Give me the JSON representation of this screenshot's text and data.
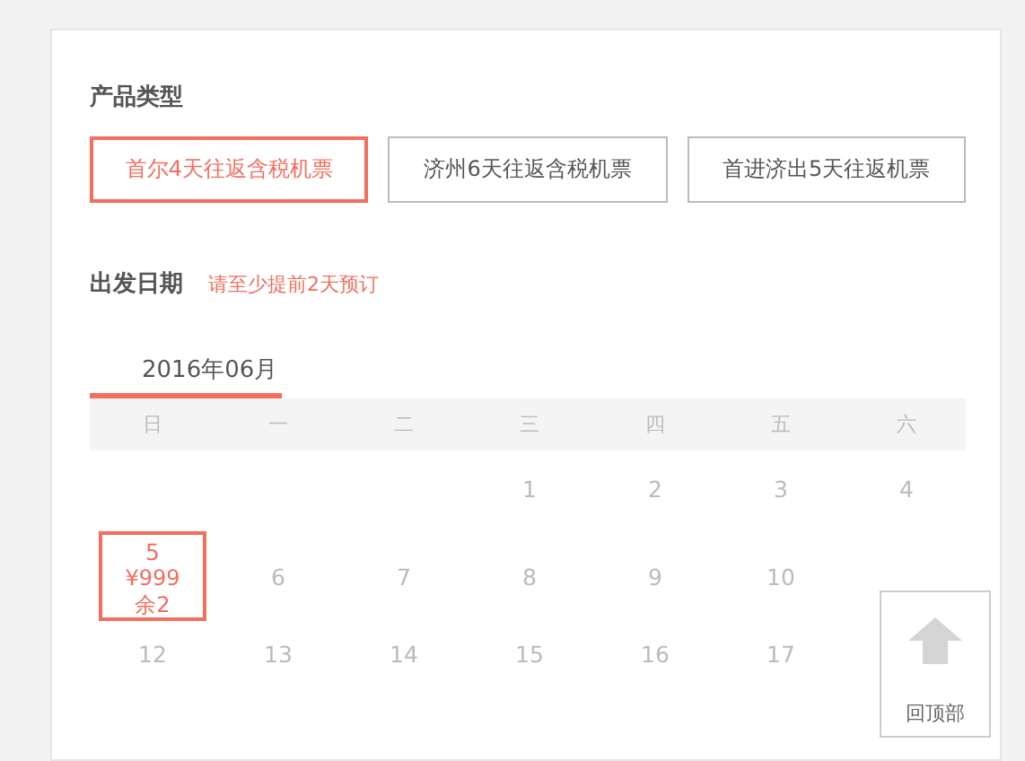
{
  "product_section": {
    "title": "产品类型",
    "options": [
      {
        "label": "首尔4天往返含税机票",
        "selected": true
      },
      {
        "label": "济州6天往返含税机票",
        "selected": false
      },
      {
        "label": "首进济出5天往返机票",
        "selected": false
      }
    ]
  },
  "date_section": {
    "title": "出发日期",
    "hint": "请至少提前2天预订",
    "month_tabs": [
      {
        "label": "2016年06月",
        "selected": true
      }
    ],
    "weekdays": [
      "日",
      "一",
      "二",
      "三",
      "四",
      "五",
      "六"
    ],
    "weeks": [
      [
        {
          "day": "1",
          "selected": false
        },
        {
          "day": "2",
          "selected": false
        },
        {
          "day": "3",
          "selected": false
        },
        {
          "day": "4",
          "selected": false
        }
      ],
      [
        {
          "day": "5",
          "price": "¥999",
          "stock": "余2",
          "selected": true
        },
        {
          "day": "6",
          "selected": false
        },
        {
          "day": "7",
          "selected": false
        },
        {
          "day": "8",
          "selected": false
        },
        {
          "day": "9",
          "selected": false
        },
        {
          "day": "10",
          "selected": false
        }
      ],
      [
        {
          "day": "12",
          "selected": false
        },
        {
          "day": "13",
          "selected": false
        },
        {
          "day": "14",
          "selected": false
        },
        {
          "day": "15",
          "selected": false
        },
        {
          "day": "16",
          "selected": false
        },
        {
          "day": "17",
          "selected": false
        }
      ]
    ]
  },
  "back_to_top": {
    "label": "回顶部"
  }
}
